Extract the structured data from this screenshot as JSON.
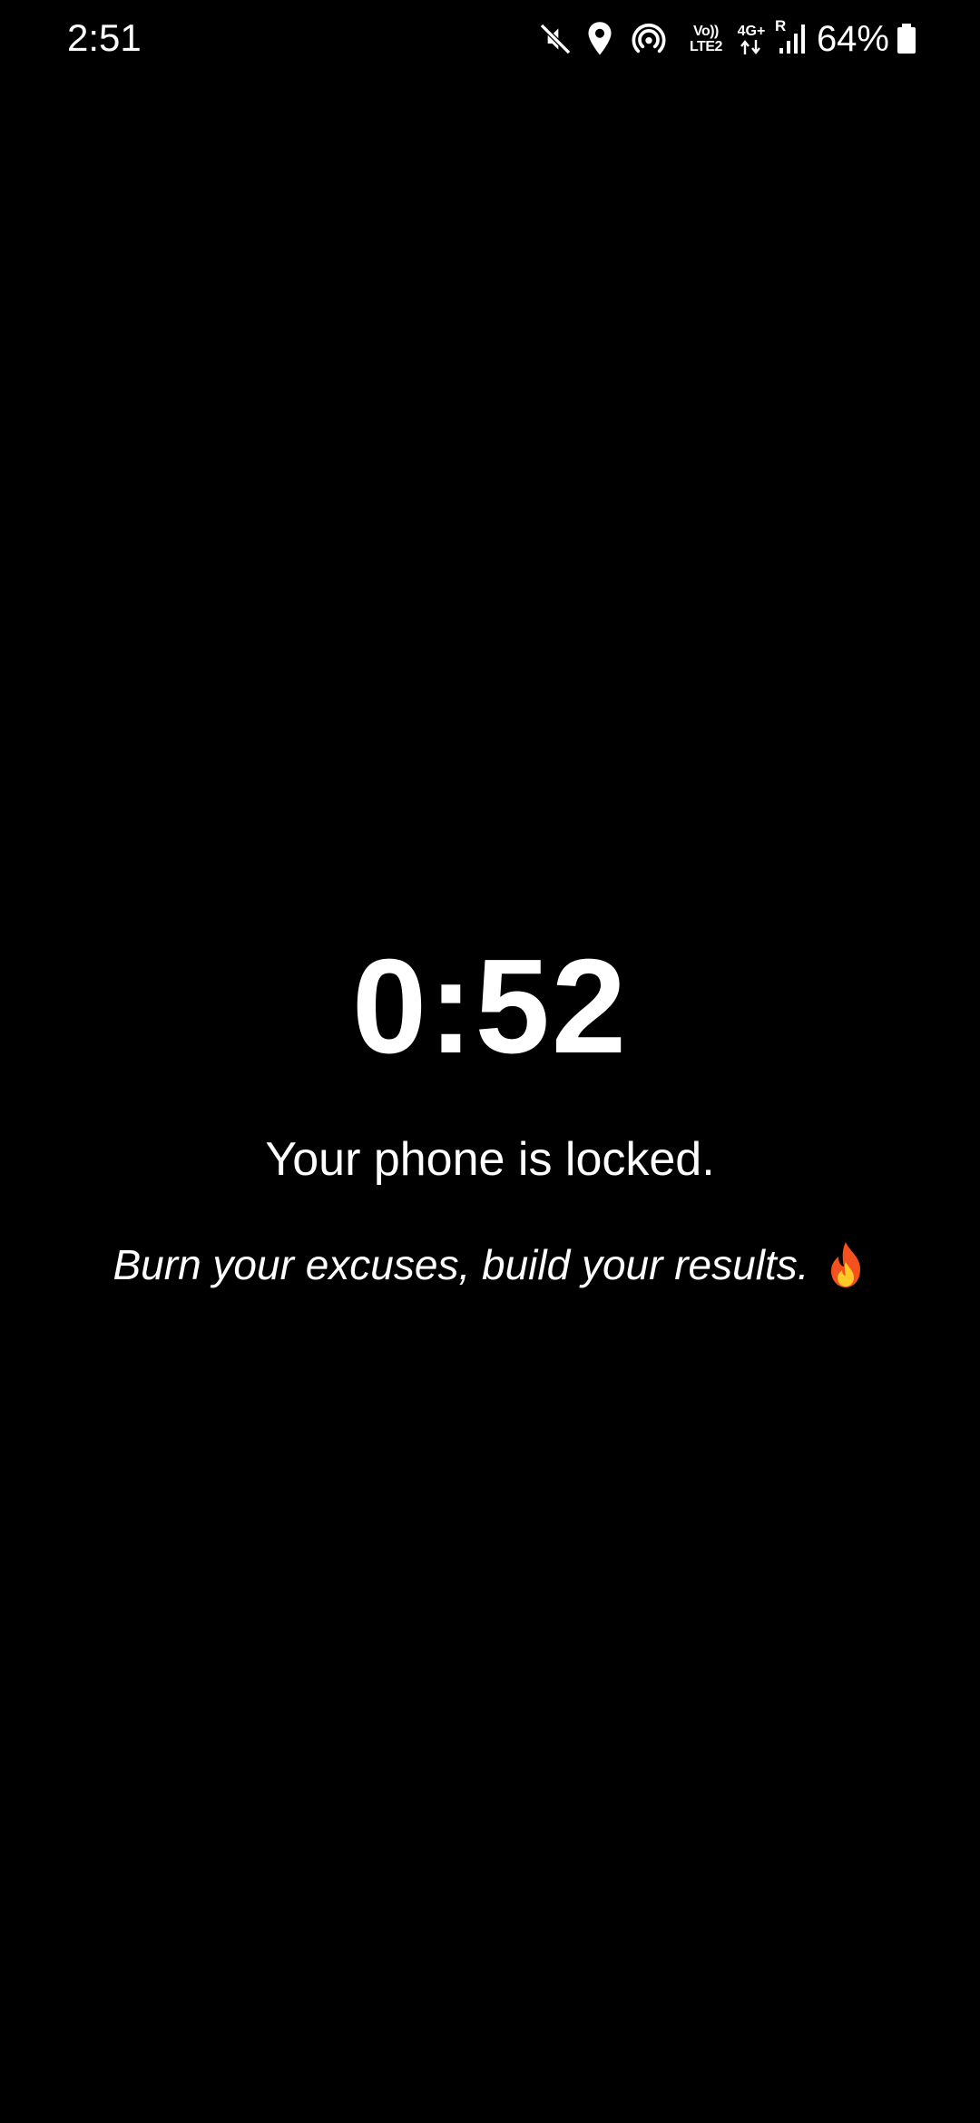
{
  "status_bar": {
    "time": "2:51",
    "volte_top": "Vo))",
    "volte_bottom": "LTE2",
    "network_type": "4G+",
    "roaming": "R",
    "battery_percent": "64%",
    "icons": [
      "mute-icon",
      "location-icon",
      "hotspot-icon",
      "volte-icon",
      "data-4g-icon",
      "signal-icon",
      "battery-icon"
    ]
  },
  "lock_screen": {
    "countdown": "0:52",
    "message": "Your phone is locked.",
    "motivation": "Burn your excuses, build your results.",
    "emoji_icon": "fire-icon"
  },
  "colors": {
    "background": "#000000",
    "text": "#ffffff",
    "flame_outer": "#f4511e",
    "flame_inner": "#ffca28"
  }
}
